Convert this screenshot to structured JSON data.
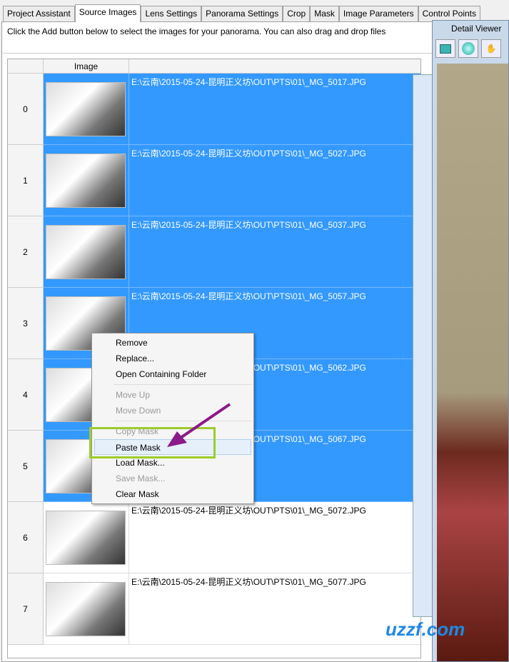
{
  "tabs": [
    "Project Assistant",
    "Source Images",
    "Lens Settings",
    "Panorama Settings",
    "Crop",
    "Mask",
    "Image Parameters",
    "Control Points"
  ],
  "active_tab": "Source Images",
  "hint": "Click the Add button below to select the images for your panorama. You can also drag and drop files",
  "table": {
    "header": "Image",
    "rows": [
      {
        "index": "0",
        "path": "E:\\云南\\2015-05-24-昆明正义坊\\OUT\\PTS\\01\\_MG_5017.JPG",
        "selected": true
      },
      {
        "index": "1",
        "path": "E:\\云南\\2015-05-24-昆明正义坊\\OUT\\PTS\\01\\_MG_5027.JPG",
        "selected": true
      },
      {
        "index": "2",
        "path": "E:\\云南\\2015-05-24-昆明正义坊\\OUT\\PTS\\01\\_MG_5037.JPG",
        "selected": true
      },
      {
        "index": "3",
        "path": "E:\\云南\\2015-05-24-昆明正义坊\\OUT\\PTS\\01\\_MG_5057.JPG",
        "selected": true
      },
      {
        "index": "4",
        "path": "E:\\云南\\2015-05-24-昆明正义坊\\OUT\\PTS\\01\\_MG_5062.JPG",
        "selected": true
      },
      {
        "index": "5",
        "path": "E:\\云南\\2015-05-24-昆明正义坊\\OUT\\PTS\\01\\_MG_5067.JPG",
        "selected": true
      },
      {
        "index": "6",
        "path": "E:\\云南\\2015-05-24-昆明正义坊\\OUT\\PTS\\01\\_MG_5072.JPG",
        "selected": false
      },
      {
        "index": "7",
        "path": "E:\\云南\\2015-05-24-昆明正义坊\\OUT\\PTS\\01\\_MG_5077.JPG",
        "selected": false
      }
    ]
  },
  "context_menu": [
    {
      "label": "Remove",
      "enabled": true
    },
    {
      "label": "Replace...",
      "enabled": true
    },
    {
      "label": "Open Containing Folder",
      "enabled": true
    },
    {
      "sep": true
    },
    {
      "label": "Move Up",
      "enabled": false
    },
    {
      "label": "Move Down",
      "enabled": false
    },
    {
      "sep": true
    },
    {
      "label": "Copy Mask",
      "enabled": false
    },
    {
      "label": "Paste Mask",
      "enabled": true,
      "highlighted": true
    },
    {
      "label": "Load Mask...",
      "enabled": true
    },
    {
      "label": "Save Mask...",
      "enabled": false
    },
    {
      "label": "Clear Mask",
      "enabled": true
    }
  ],
  "detail_viewer": {
    "title": "Detail Viewer"
  },
  "watermark": "uzzf.com",
  "colors": {
    "selection": "#3399ff",
    "highlight_box": "#9ccc2c",
    "arrow": "#8b1a8b"
  }
}
